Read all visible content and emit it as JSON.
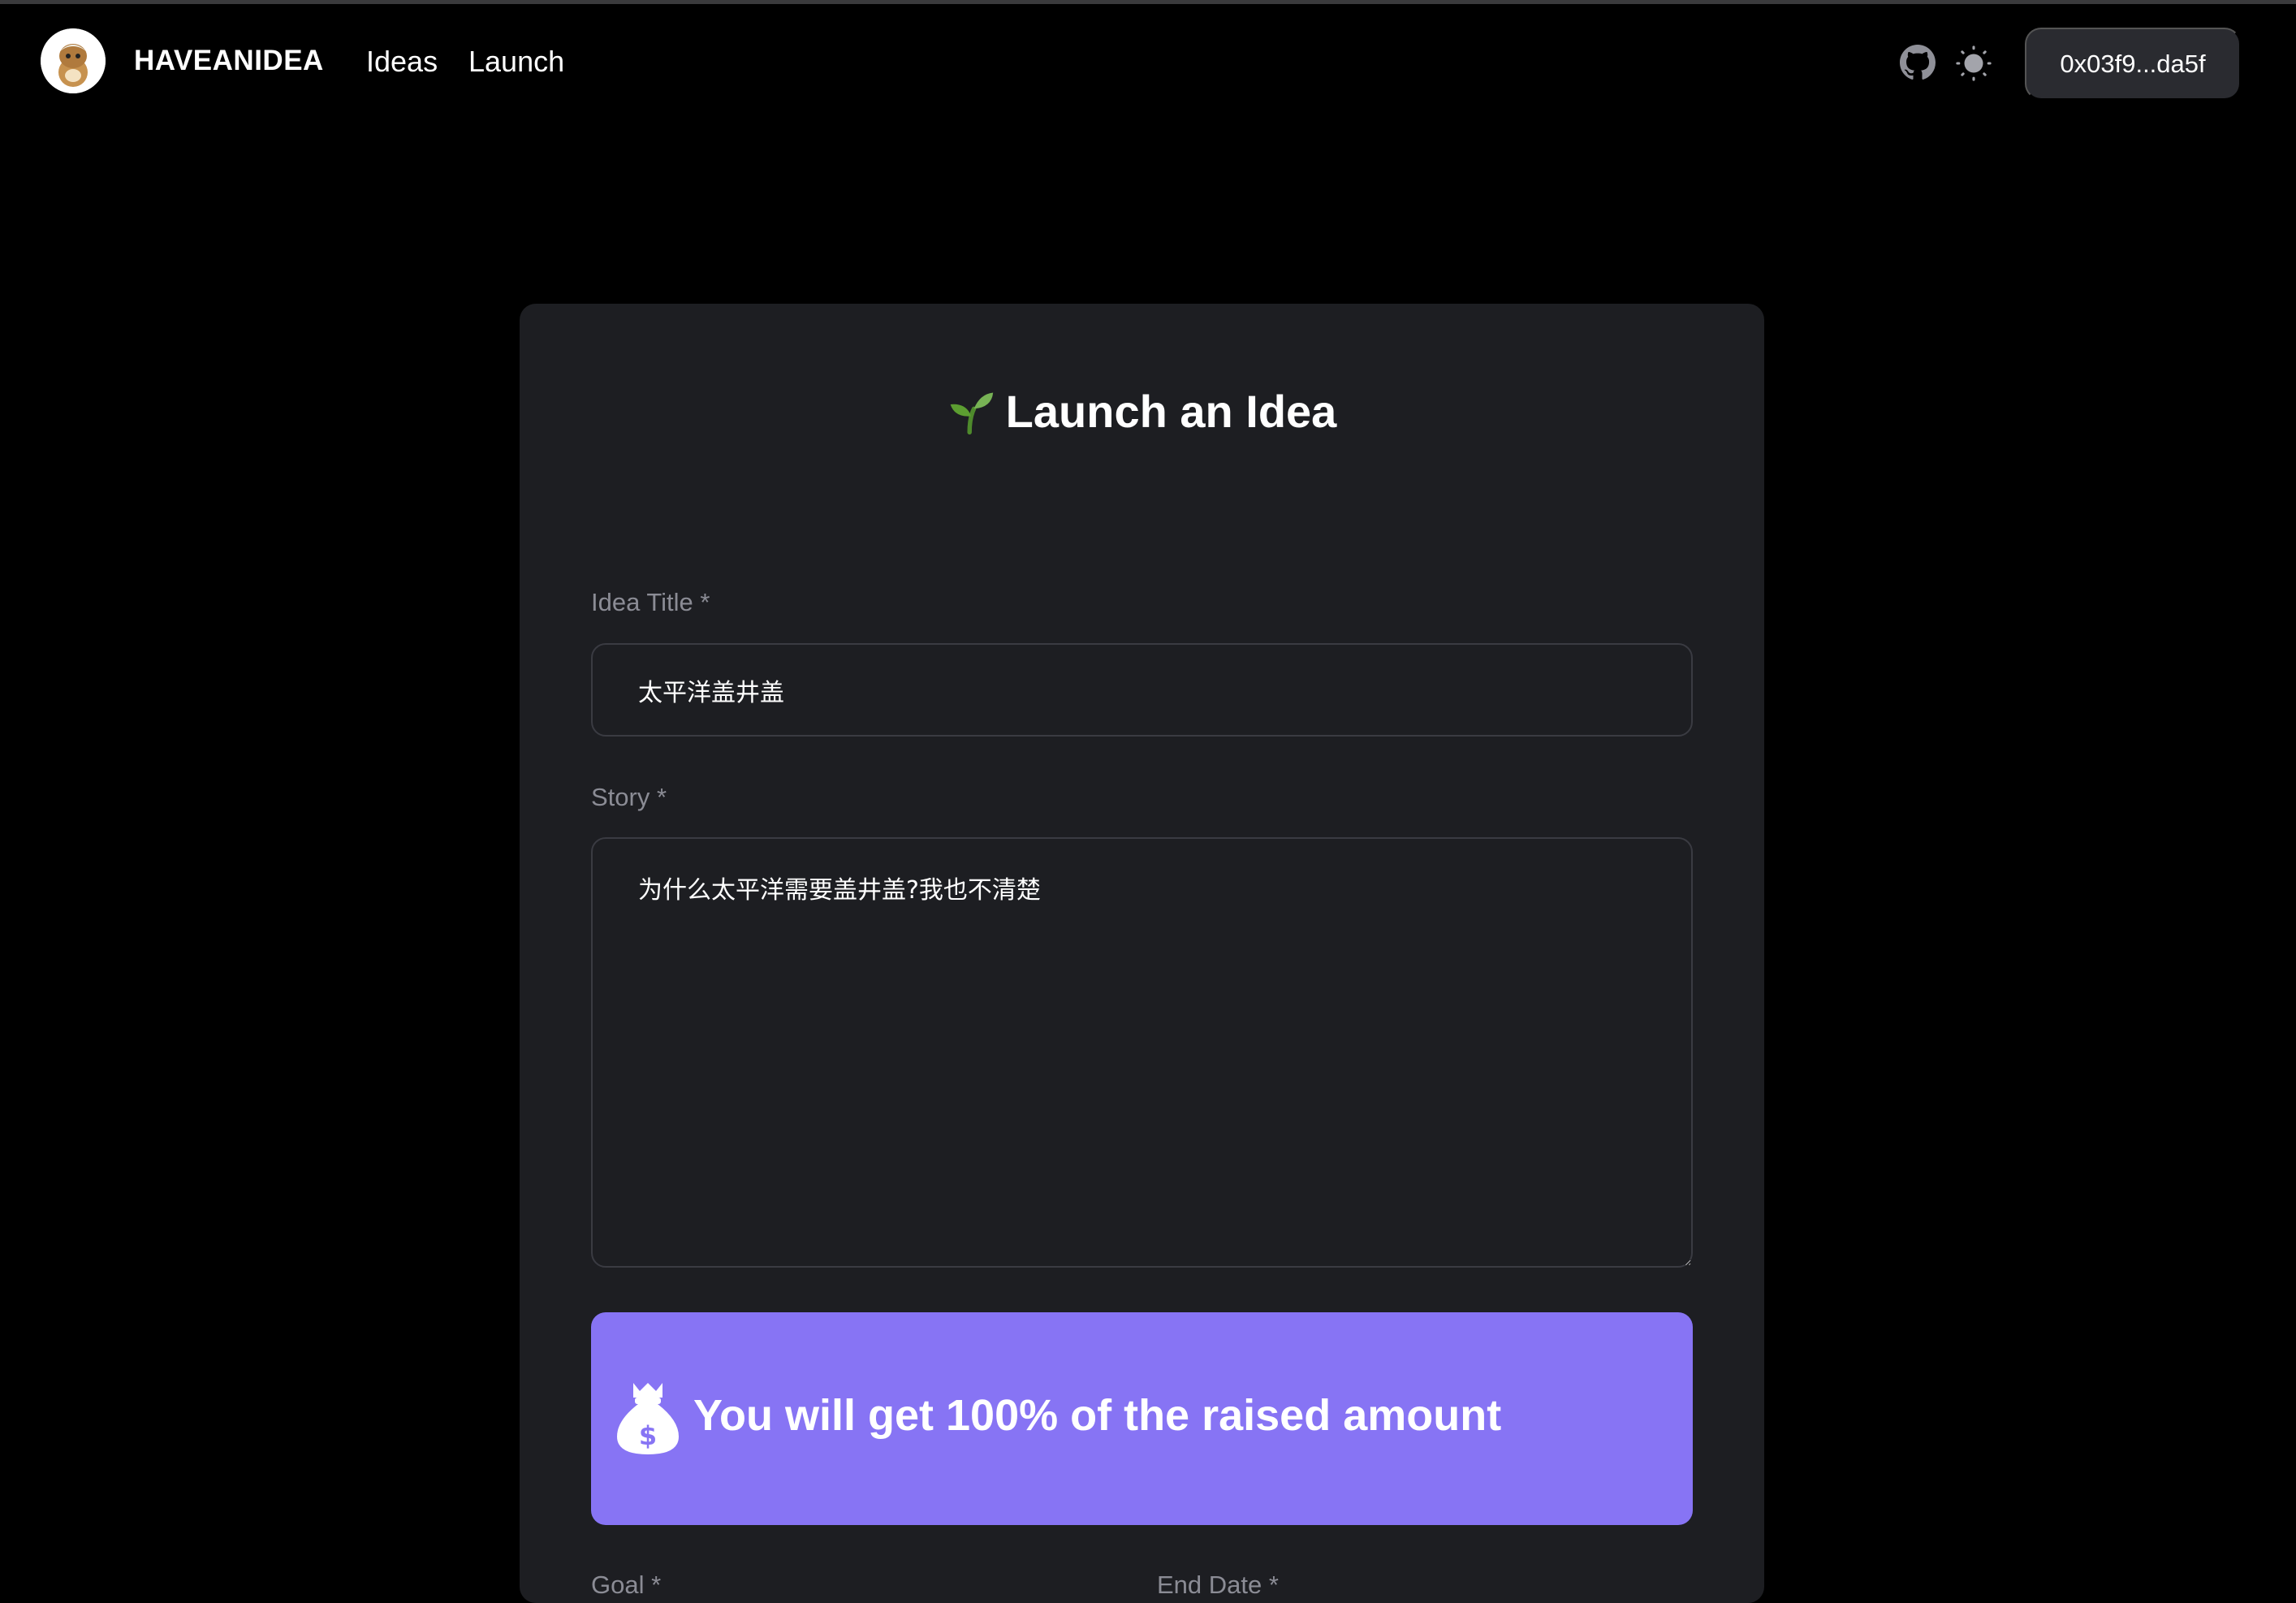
{
  "header": {
    "brand": "HAVEANIDEA",
    "nav": [
      {
        "label": "Ideas"
      },
      {
        "label": "Launch"
      }
    ],
    "icons": [
      "github-icon",
      "sun-icon"
    ],
    "wallet_address": "0x03f9...da5f"
  },
  "form": {
    "heading": "Launch an Idea",
    "heading_icon": "sprout-icon",
    "title_label": "Idea Title *",
    "title_value": "太平洋盖井盖",
    "story_label": "Story *",
    "story_value": "为什么太平洋需要盖井盖?我也不清楚",
    "banner_icon": "money-bag-icon",
    "banner_text": "You will get 100% of the raised amount",
    "goal_label": "Goal *",
    "end_date_label": "End Date *"
  },
  "colors": {
    "background": "#000000",
    "card": "#1d1e22",
    "accent": "#8774f4",
    "wallet_button": "#2a2b30",
    "muted_label": "#8b8c95"
  }
}
